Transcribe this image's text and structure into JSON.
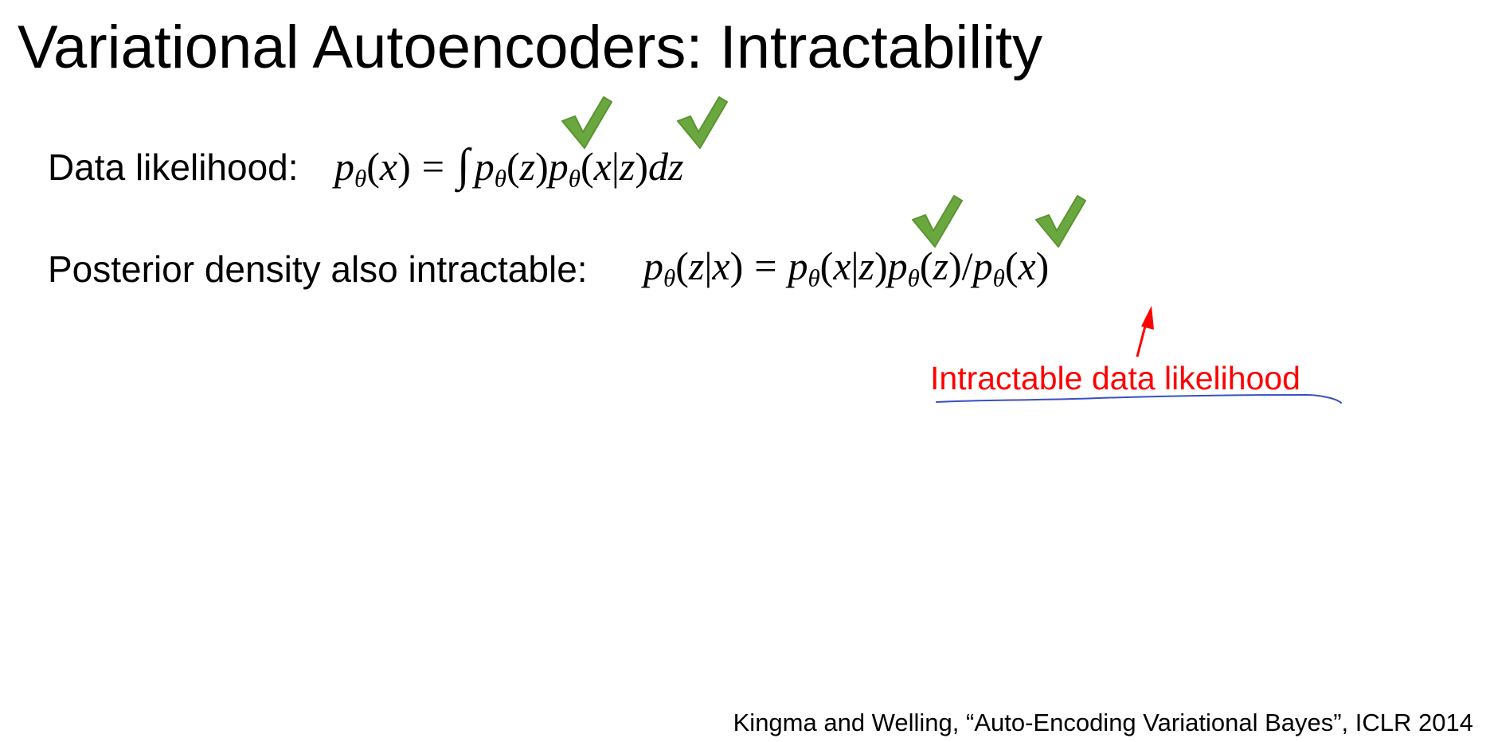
{
  "slide": {
    "title": "Variational Autoencoders: Intractability",
    "rows": [
      {
        "label": "Data likelihood:",
        "equation": "pθ(x) = ∫ pθ(z)pθ(x|z)dz"
      },
      {
        "label": "Posterior density also intractable:",
        "equation": "pθ(z|x) = pθ(x|z)pθ(z)/pθ(x)"
      }
    ],
    "annotation": "Intractable data likelihood",
    "citation": "Kingma and Welling, “Auto-Encoding Variational Bayes”, ICLR 2014"
  },
  "colors": {
    "checkmark": "#6aa83f",
    "annotation": "#ff0000",
    "underline": "#3a4fbf"
  },
  "icons": [
    "check-icon",
    "arrow-up-icon"
  ]
}
